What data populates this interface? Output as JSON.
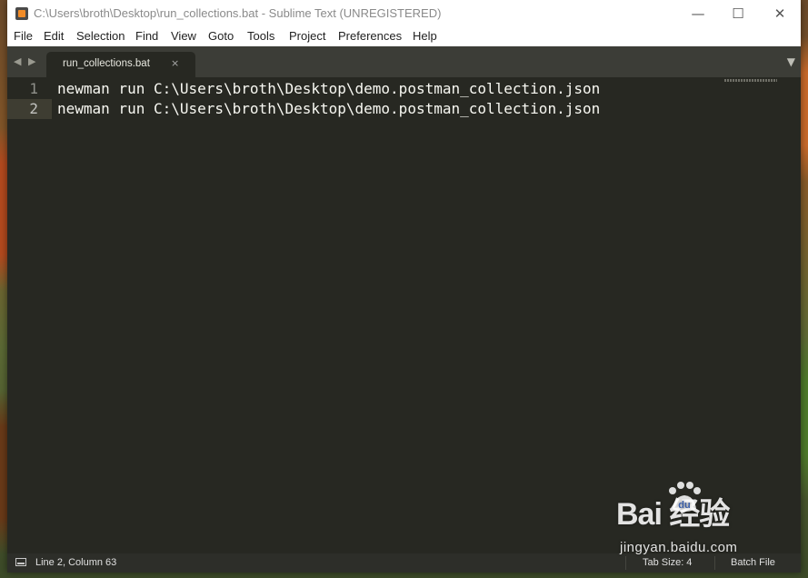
{
  "window": {
    "title": "C:\\Users\\broth\\Desktop\\run_collections.bat - Sublime Text (UNREGISTERED)",
    "controls": {
      "minimize": "—",
      "maximize": "☐",
      "close": "✕"
    }
  },
  "menu": [
    "File",
    "Edit",
    "Selection",
    "Find",
    "View",
    "Goto",
    "Tools",
    "Project",
    "Preferences",
    "Help"
  ],
  "tabs": [
    {
      "label": "run_collections.bat",
      "close": "×",
      "active": true
    }
  ],
  "nav": {
    "back": "◀",
    "forward": "▶",
    "dropdown": "▼"
  },
  "editor": {
    "lines": [
      {
        "number": "1",
        "text": "newman run C:\\Users\\broth\\Desktop\\demo.postman_collection.json"
      },
      {
        "number": "2",
        "text": "newman run C:\\Users\\broth\\Desktop\\demo.postman_collection.json"
      }
    ],
    "current_line": 2
  },
  "status": {
    "position": "Line 2, Column 63",
    "tab_size": "Tab Size: 4",
    "syntax": "Batch File"
  },
  "watermark": {
    "brand": "Bai  经验",
    "site": "jingyan.baidu.com",
    "du": "du"
  },
  "colors": {
    "editor_bg": "#272822",
    "text": "#f8f8f2",
    "gutter": "#8f908a",
    "tabbar_bg": "#3c3d37",
    "statusbar_bg": "#2d2e29"
  }
}
